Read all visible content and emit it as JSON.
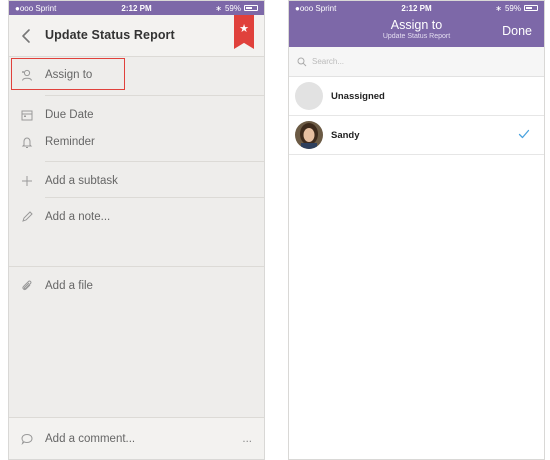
{
  "colors": {
    "accent": "#7d68a8",
    "flag": "#e0413c",
    "check": "#4aa3df",
    "highlight": "#e0413c"
  },
  "left_screen": {
    "status_bar": {
      "carrier": "●ooo Sprint",
      "time": "2:12 PM",
      "battery": "59%"
    },
    "header": {
      "title": "Update Status Report",
      "back_icon": "chevron-left-icon",
      "star_icon": "star-icon"
    },
    "rows": {
      "assign_to": "Assign to",
      "due_date": "Due Date",
      "reminder": "Reminder",
      "add_subtask": "Add a subtask",
      "add_note": "Add a note...",
      "add_file": "Add a file"
    },
    "comment": {
      "placeholder": "Add a comment...",
      "more": "..."
    }
  },
  "right_screen": {
    "status_bar": {
      "carrier": "●ooo Sprint",
      "time": "2:12 PM",
      "battery": "59%"
    },
    "nav": {
      "title": "Assign to",
      "subtitle": "Update Status Report",
      "done_label": "Done"
    },
    "search": {
      "placeholder": "Search..."
    },
    "assignees": [
      {
        "name": "Unassigned",
        "selected": false
      },
      {
        "name": "Sandy",
        "selected": true
      }
    ]
  }
}
